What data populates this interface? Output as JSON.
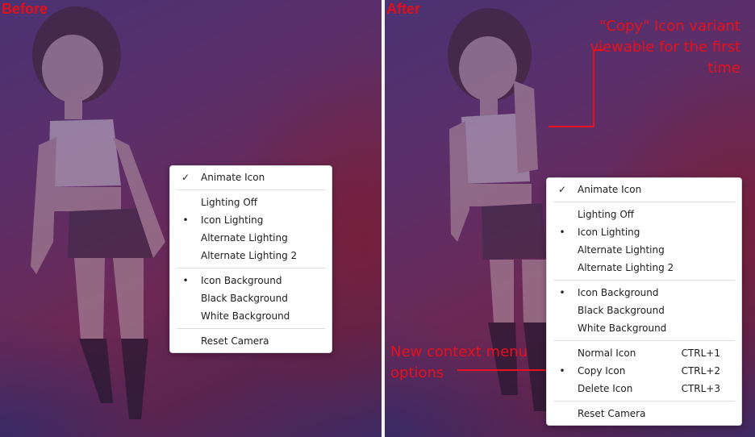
{
  "labels": {
    "before": "Before",
    "after": "After"
  },
  "annotations": {
    "copy_icon": "\"Copy\" Icon variant viewable for the first time",
    "new_options": "New context menu options",
    "color": "#e8101c"
  },
  "menu_before": {
    "animate_icon": "Animate Icon",
    "lighting_off": "Lighting Off",
    "icon_lighting": "Icon Lighting",
    "alternate_lighting": "Alternate Lighting",
    "alternate_lighting_2": "Alternate Lighting 2",
    "icon_background": "Icon Background",
    "black_background": "Black Background",
    "white_background": "White Background",
    "reset_camera": "Reset Camera"
  },
  "menu_after": {
    "animate_icon": "Animate Icon",
    "lighting_off": "Lighting Off",
    "icon_lighting": "Icon Lighting",
    "alternate_lighting": "Alternate Lighting",
    "alternate_lighting_2": "Alternate Lighting 2",
    "icon_background": "Icon Background",
    "black_background": "Black Background",
    "white_background": "White Background",
    "normal_icon": "Normal Icon",
    "normal_icon_shortcut": "CTRL+1",
    "copy_icon": "Copy Icon",
    "copy_icon_shortcut": "CTRL+2",
    "delete_icon": "Delete Icon",
    "delete_icon_shortcut": "CTRL+3",
    "reset_camera": "Reset Camera"
  },
  "marks": {
    "check": "✓",
    "bullet": "•"
  }
}
